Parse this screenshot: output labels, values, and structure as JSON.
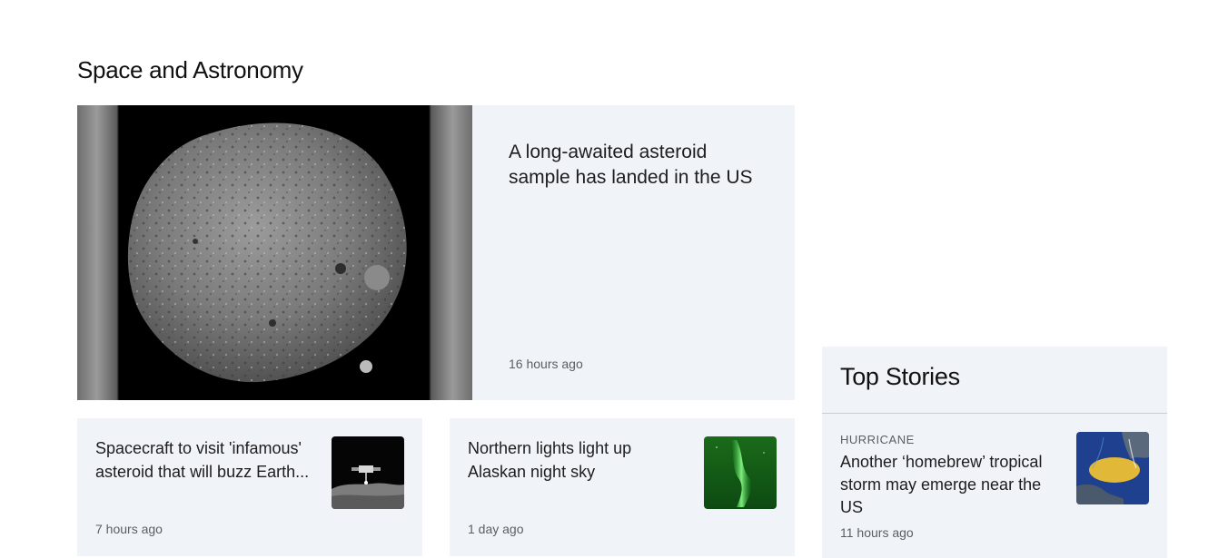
{
  "section": {
    "title": "Space and Astronomy"
  },
  "hero": {
    "headline": "A long-awaited asteroid sample has landed in the US",
    "time": "16 hours ago",
    "image": "asteroid-photo"
  },
  "cards": [
    {
      "headline": "Spacecraft to visit 'infamous' asteroid that will buzz Earth...",
      "time": "7 hours ago",
      "image": "spacecraft-over-asteroid-thumbnail"
    },
    {
      "headline": "Northern lights light up Alaskan night sky",
      "time": "1 day ago",
      "image": "aurora-thumbnail"
    }
  ],
  "top_stories": {
    "title": "Top Stories",
    "items": [
      {
        "category": "HURRICANE",
        "headline": "Another ‘homebrew’ tropical storm may emerge near the US",
        "time": "11 hours ago",
        "image": "storm-map-thumbnail"
      }
    ]
  }
}
